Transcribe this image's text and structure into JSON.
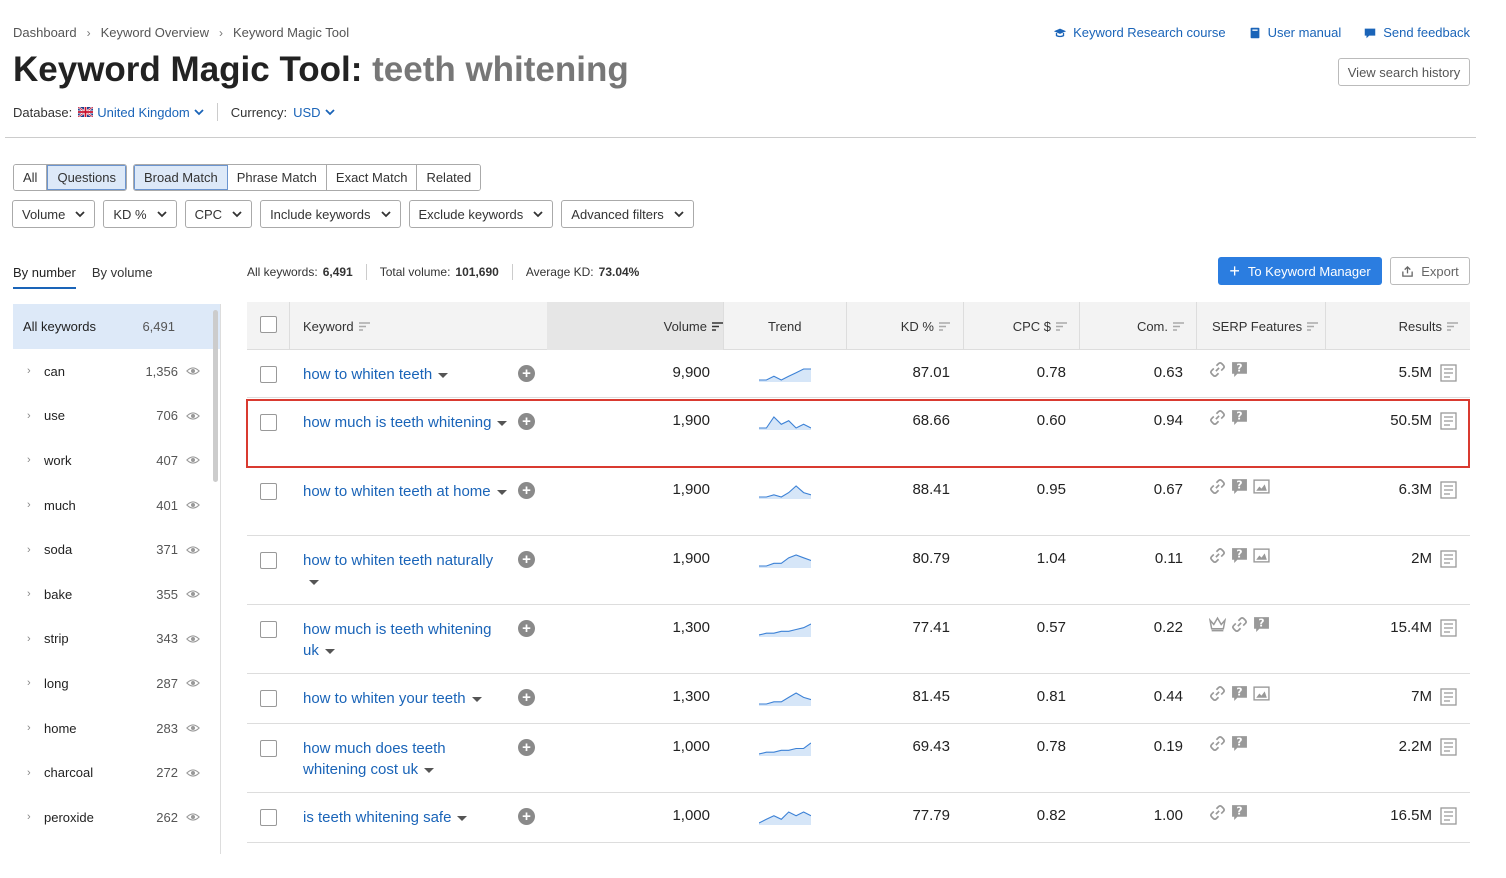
{
  "breadcrumb": [
    "Dashboard",
    "Keyword Overview",
    "Keyword Magic Tool"
  ],
  "top_links": [
    {
      "label": "Keyword Research course",
      "icon": "graduation-cap-icon"
    },
    {
      "label": "User manual",
      "icon": "book-icon"
    },
    {
      "label": "Send feedback",
      "icon": "speech-bubble-icon"
    }
  ],
  "title": {
    "prefix": "Keyword Magic Tool:",
    "query": "teeth whitening"
  },
  "view_history": "View search history",
  "database": {
    "label": "Database:",
    "value": "United Kingdom"
  },
  "currency": {
    "label": "Currency:",
    "value": "USD"
  },
  "match_group1": [
    {
      "label": "All",
      "selected": false
    },
    {
      "label": "Questions",
      "selected": true
    }
  ],
  "match_group2": [
    {
      "label": "Broad Match",
      "selected": true
    },
    {
      "label": "Phrase Match",
      "selected": false
    },
    {
      "label": "Exact Match",
      "selected": false
    },
    {
      "label": "Related",
      "selected": false
    }
  ],
  "filters": [
    "Volume",
    "KD %",
    "CPC",
    "Include keywords",
    "Exclude keywords",
    "Advanced filters"
  ],
  "tabs": [
    {
      "label": "By number",
      "active": true
    },
    {
      "label": "By volume",
      "active": false
    }
  ],
  "summary": {
    "all_label": "All keywords:",
    "all_value": "6,491",
    "volume_label": "Total volume:",
    "volume_value": "101,690",
    "kd_label": "Average KD:",
    "kd_value": "73.04%"
  },
  "to_manager": "To Keyword Manager",
  "export": "Export",
  "sidebar": {
    "all_label": "All keywords",
    "all_count": "6,491",
    "items": [
      {
        "label": "can",
        "count": "1,356"
      },
      {
        "label": "use",
        "count": "706"
      },
      {
        "label": "work",
        "count": "407"
      },
      {
        "label": "much",
        "count": "401"
      },
      {
        "label": "soda",
        "count": "371"
      },
      {
        "label": "bake",
        "count": "355"
      },
      {
        "label": "strip",
        "count": "343"
      },
      {
        "label": "long",
        "count": "287"
      },
      {
        "label": "home",
        "count": "283"
      },
      {
        "label": "charcoal",
        "count": "272"
      },
      {
        "label": "peroxide",
        "count": "262"
      }
    ]
  },
  "columns": [
    "Keyword",
    "Volume",
    "Trend",
    "KD %",
    "CPC $",
    "Com.",
    "SERP Features",
    "Results"
  ],
  "rows": [
    {
      "keyword": "how to whiten teeth",
      "volume": "9,900",
      "kd": "87.01",
      "cpc": "0.78",
      "com": "0.63",
      "serp": [
        "link-icon",
        "question-icon"
      ],
      "results": "5.5M",
      "trend": [
        3,
        3,
        4,
        3,
        4,
        5,
        6,
        6
      ],
      "highlighted": false
    },
    {
      "keyword": "how much is teeth whitening",
      "volume": "1,900",
      "kd": "68.66",
      "cpc": "0.60",
      "com": "0.94",
      "serp": [
        "link-icon",
        "question-icon"
      ],
      "results": "50.5M",
      "trend": [
        4,
        4,
        7,
        5,
        6,
        4,
        5,
        4
      ],
      "highlighted": true
    },
    {
      "keyword": "how to whiten teeth at home",
      "volume": "1,900",
      "kd": "88.41",
      "cpc": "0.95",
      "com": "0.67",
      "serp": [
        "link-icon",
        "question-icon",
        "image-icon"
      ],
      "results": "6.3M",
      "trend": [
        3,
        3,
        4,
        3,
        5,
        8,
        5,
        4
      ],
      "highlighted": false
    },
    {
      "keyword": "how to whiten teeth naturally",
      "volume": "1,900",
      "kd": "80.79",
      "cpc": "1.04",
      "com": "0.11",
      "serp": [
        "link-icon",
        "question-icon",
        "image-icon"
      ],
      "results": "2M",
      "trend": [
        3,
        3,
        4,
        4,
        6,
        7,
        6,
        5
      ],
      "highlighted": false
    },
    {
      "keyword": "how much is teeth whitening uk",
      "volume": "1,300",
      "kd": "77.41",
      "cpc": "0.57",
      "com": "0.22",
      "serp": [
        "crown-icon",
        "link-icon",
        "question-icon"
      ],
      "results": "15.4M",
      "trend": [
        2,
        3,
        3,
        4,
        4,
        5,
        6,
        8
      ],
      "highlighted": false
    },
    {
      "keyword": "how to whiten your teeth",
      "volume": "1,300",
      "kd": "81.45",
      "cpc": "0.81",
      "com": "0.44",
      "serp": [
        "link-icon",
        "question-icon",
        "image-icon"
      ],
      "results": "7M",
      "trend": [
        3,
        3,
        4,
        4,
        6,
        8,
        6,
        5
      ],
      "highlighted": false
    },
    {
      "keyword": "how much does teeth whitening cost uk",
      "volume": "1,000",
      "kd": "69.43",
      "cpc": "0.78",
      "com": "0.19",
      "serp": [
        "link-icon",
        "question-icon"
      ],
      "results": "2.2M",
      "trend": [
        2,
        3,
        3,
        4,
        4,
        5,
        5,
        8
      ],
      "highlighted": false
    },
    {
      "keyword": "is teeth whitening safe",
      "volume": "1,000",
      "kd": "77.79",
      "cpc": "0.82",
      "com": "1.00",
      "serp": [
        "link-icon",
        "question-icon"
      ],
      "results": "16.5M",
      "trend": [
        3,
        4,
        5,
        4,
        6,
        5,
        6,
        5
      ],
      "highlighted": false
    }
  ],
  "colors": {
    "accent": "#1a64b8",
    "primary_button": "#2b7de0",
    "highlight_border": "#d93a30",
    "selected_bg": "#dde9f8"
  }
}
